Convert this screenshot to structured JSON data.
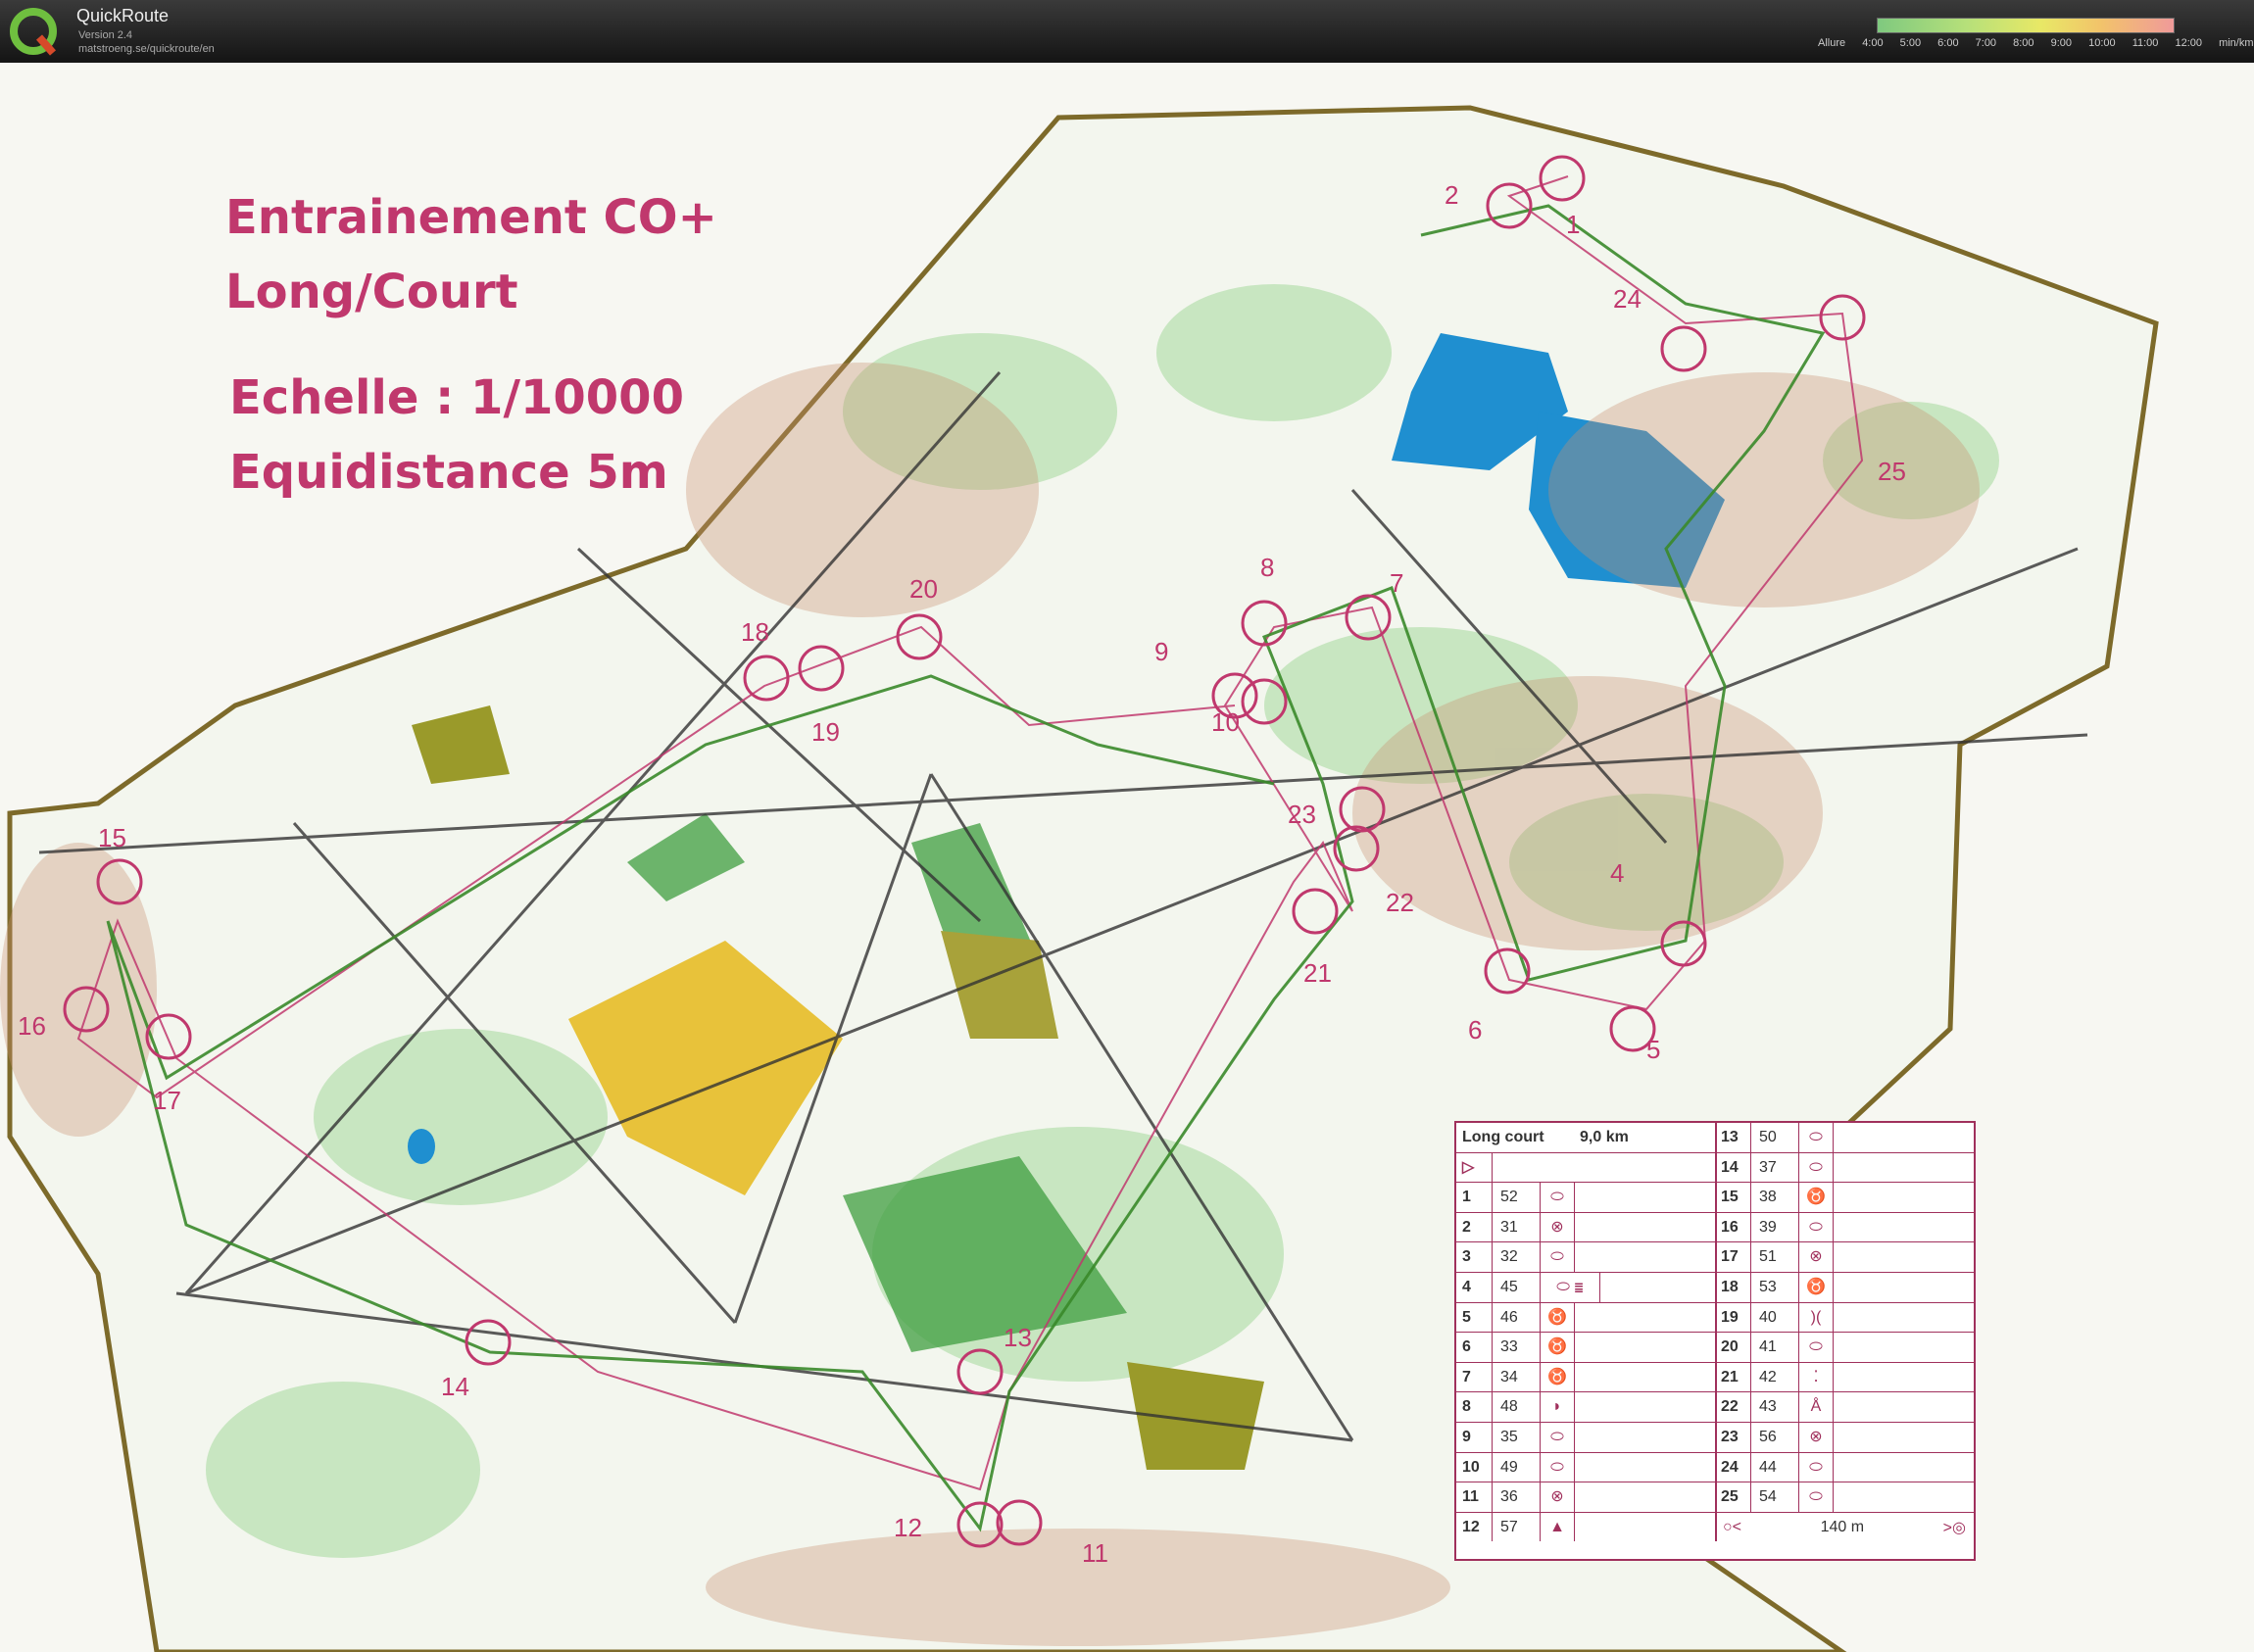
{
  "app": {
    "title": "QuickRoute",
    "version": "Version 2.4",
    "url": "matstroeng.se/quickroute/en"
  },
  "pace_legend": {
    "label": "Allure",
    "ticks": [
      "4:00",
      "5:00",
      "6:00",
      "7:00",
      "8:00",
      "9:00",
      "10:00",
      "11:00",
      "12:00"
    ],
    "unit": "min/km"
  },
  "map": {
    "title_lines": [
      "Entrainement CO+",
      "Long/Court"
    ],
    "scale": "Echelle : 1/10000",
    "contour": "Equidistance 5m",
    "controls": [
      {
        "label": "1"
      },
      {
        "label": "2"
      },
      {
        "label": "4"
      },
      {
        "label": "5"
      },
      {
        "label": "6"
      },
      {
        "label": "7"
      },
      {
        "label": "8"
      },
      {
        "label": "9"
      },
      {
        "label": "10"
      },
      {
        "label": "11"
      },
      {
        "label": "12"
      },
      {
        "label": "13"
      },
      {
        "label": "14"
      },
      {
        "label": "15"
      },
      {
        "label": "16"
      },
      {
        "label": "17"
      },
      {
        "label": "18"
      },
      {
        "label": "19"
      },
      {
        "label": "20"
      },
      {
        "label": "21"
      },
      {
        "label": "22"
      },
      {
        "label": "23"
      },
      {
        "label": "24"
      },
      {
        "label": "25"
      }
    ]
  },
  "control_table": {
    "course": "Long court",
    "distance": "9,0 km",
    "footer_distance": "140 m",
    "left": [
      {
        "n": "1",
        "code": "52",
        "sym": "⬭"
      },
      {
        "n": "2",
        "code": "31",
        "sym": "⊗"
      },
      {
        "n": "3",
        "code": "32",
        "sym": "⬭"
      },
      {
        "n": "4",
        "code": "45",
        "sym": "⬭ ≣"
      },
      {
        "n": "5",
        "code": "46",
        "sym": "♉"
      },
      {
        "n": "6",
        "code": "33",
        "sym": "♉"
      },
      {
        "n": "7",
        "code": "34",
        "sym": "♉"
      },
      {
        "n": "8",
        "code": "48",
        "sym": "◗"
      },
      {
        "n": "9",
        "code": "35",
        "sym": "⬭"
      },
      {
        "n": "10",
        "code": "49",
        "sym": "⬭"
      },
      {
        "n": "11",
        "code": "36",
        "sym": "⊗"
      },
      {
        "n": "12",
        "code": "57",
        "sym": "▲"
      }
    ],
    "right": [
      {
        "n": "13",
        "code": "50",
        "sym": "⬭"
      },
      {
        "n": "14",
        "code": "37",
        "sym": "⬭"
      },
      {
        "n": "15",
        "code": "38",
        "sym": "♉"
      },
      {
        "n": "16",
        "code": "39",
        "sym": "⬭"
      },
      {
        "n": "17",
        "code": "51",
        "sym": "⊗"
      },
      {
        "n": "18",
        "code": "53",
        "sym": "♉"
      },
      {
        "n": "19",
        "code": "40",
        "sym": ")("
      },
      {
        "n": "20",
        "code": "41",
        "sym": "⬭"
      },
      {
        "n": "21",
        "code": "42",
        "sym": "⁚"
      },
      {
        "n": "22",
        "code": "43",
        "sym": "Å"
      },
      {
        "n": "23",
        "code": "56",
        "sym": "⊗"
      },
      {
        "n": "24",
        "code": "44",
        "sym": "⬭"
      },
      {
        "n": "25",
        "code": "54",
        "sym": "⬭"
      }
    ]
  },
  "colors": {
    "course": "#c0386d",
    "forest_green": "#3f9e3f",
    "light_green": "#bfe3b8",
    "water": "#1f8fd0",
    "open_yellow": "#e8c23a",
    "olive": "#9a9a2a",
    "route": "#3a8a2a"
  }
}
